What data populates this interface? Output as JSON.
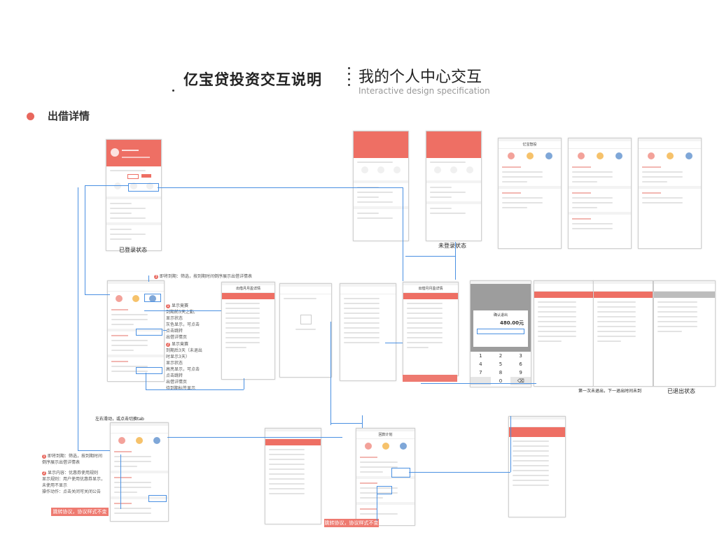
{
  "header": {
    "title": "亿宝贷投资交互说明",
    "subtitle": "我的个人中心交互",
    "subtitle_en": "Interactive design specification"
  },
  "section": {
    "title": "出借详情"
  },
  "captions": {
    "logged_in": "已登录状态",
    "logged_out": "未登录状态",
    "exited": "已退出状态",
    "first_exit_note": "第一次未退出，下一退出时间未到",
    "swipe_note": "左右滑动，或点击切换tab"
  },
  "notes": {
    "top_jump": "即将到期：筛选，按到期时间倒序展示出借详情表",
    "note_1_lines": [
      "显示竟赛",
      "到期前3天之勤,",
      "显示状态",
      "灰色显示，可点击",
      "点击跳转",
      "出借详情页"
    ],
    "note_2_lines": [
      "显示竟赛",
      "到期后3天（未退出",
      "时显示3天）",
      "显示状态",
      "高亮显示，可点击",
      "点击跳转",
      "出借详情页",
      "待到期标签显示"
    ],
    "left_note_1_lines": [
      "即将到期：筛选，按到期时间",
      "倒序展示出借详情表"
    ],
    "left_note_2_lines": [
      "显示内容：优惠券使用规则",
      "显示规则：用户使用优惠券显示，",
      "未使用不显示",
      "操作动作：点击关闭可关闭公告"
    ]
  },
  "buttons": {
    "agreement_1": "跳转协议，协议样式不变",
    "agreement_2": "跳转协议，协议样式不变"
  },
  "exit_dialog": {
    "title": "确认退出",
    "amount": "480.00元"
  },
  "keypad": {
    "keys": [
      "1",
      "2",
      "3",
      "4",
      "5",
      "6",
      "7",
      "8",
      "9",
      "0"
    ]
  },
  "phone_labels": {
    "record": "亿宝智投",
    "detail": "出借月月盈详情",
    "exit_detail": "出借月月盈详情",
    "repay": "回款计划"
  },
  "colors": {
    "accent": "#ee6f64",
    "connector": "#4a90e2",
    "bullet": "#e8675d"
  }
}
